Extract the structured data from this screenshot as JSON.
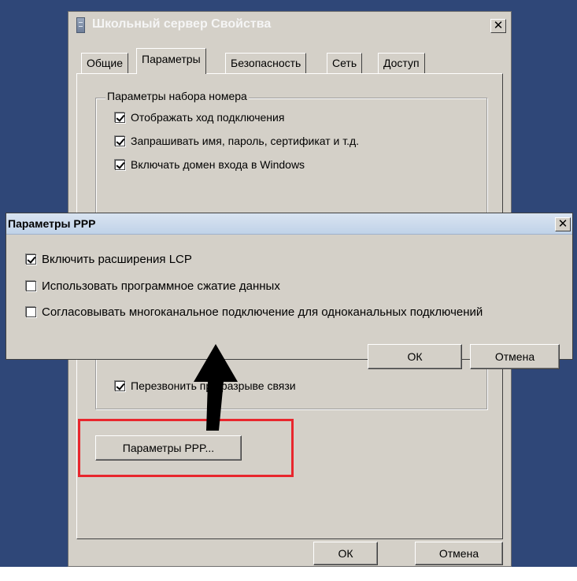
{
  "main_window": {
    "title": "Школьный сервер Свойства",
    "close_glyph": "✕",
    "tabs": [
      {
        "label": "Общие",
        "active": false
      },
      {
        "label": "Параметры",
        "active": true
      },
      {
        "label": "Безопасность",
        "active": false
      },
      {
        "label": "Сеть",
        "active": false
      },
      {
        "label": "Доступ",
        "active": false
      }
    ],
    "group_label": "Параметры набора номера",
    "options": [
      {
        "label": "Отображать ход подключения",
        "checked": true
      },
      {
        "label": "Запрашивать имя, пароль, сертификат и т.д.",
        "checked": true
      },
      {
        "label": "Включать домен входа в Windows",
        "checked": true
      }
    ],
    "redial_option": {
      "label": "Перезвонить при разрыве связи",
      "checked": true
    },
    "ppp_button_label": "Параметры PPP...",
    "ok_label": "ОК",
    "cancel_label": "Отмена"
  },
  "ppp_dialog": {
    "title": "Параметры PPP",
    "close_glyph": "✕",
    "options": [
      {
        "label": "Включить расширения LCP",
        "checked": true
      },
      {
        "label": "Использовать программное сжатие данных",
        "checked": false
      },
      {
        "label": "Согласовывать многоканальное подключение для одноканальных подключений",
        "checked": false
      }
    ],
    "ok_label": "ОК",
    "cancel_label": "Отмена"
  },
  "colors": {
    "desktop": "#2f4778",
    "highlight": "#e8262d",
    "arrow": "#000000"
  },
  "icons": {
    "app": "server-icon",
    "annotation": "up-arrow-icon"
  }
}
